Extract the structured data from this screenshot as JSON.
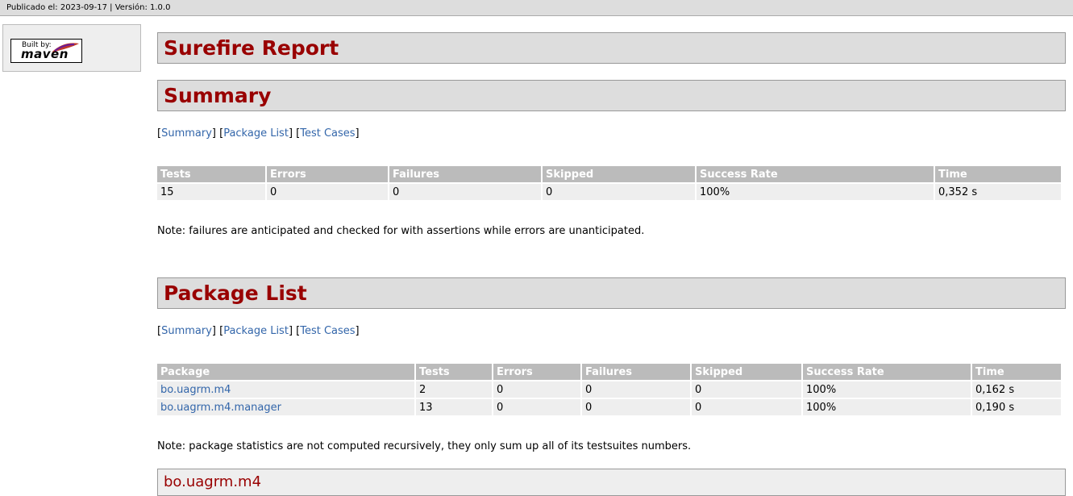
{
  "header": {
    "published": "Publicado el: 2023-09-17 | Versión: 1.0.0"
  },
  "sidebar": {
    "logo_built_by": "Built by:",
    "logo_name": "maven"
  },
  "page_title": "Surefire Report",
  "nav": {
    "summary": "Summary",
    "package_list": "Package List",
    "test_cases": "Test Cases"
  },
  "summary": {
    "title": "Summary",
    "headers": [
      "Tests",
      "Errors",
      "Failures",
      "Skipped",
      "Success Rate",
      "Time"
    ],
    "row": [
      "15",
      "0",
      "0",
      "0",
      "100%",
      "0,352 s"
    ],
    "note": "Note: failures are anticipated and checked for with assertions while errors are unanticipated."
  },
  "packages": {
    "title": "Package List",
    "headers": [
      "Package",
      "Tests",
      "Errors",
      "Failures",
      "Skipped",
      "Success Rate",
      "Time"
    ],
    "rows": [
      [
        "bo.uagrm.m4",
        "2",
        "0",
        "0",
        "0",
        "100%",
        "0,162 s"
      ],
      [
        "bo.uagrm.m4.manager",
        "13",
        "0",
        "0",
        "0",
        "100%",
        "0,190 s"
      ]
    ],
    "note": "Note: package statistics are not computed recursively, they only sum up all of its testsuites numbers."
  },
  "package_section": {
    "title": "bo.uagrm.m4"
  }
}
